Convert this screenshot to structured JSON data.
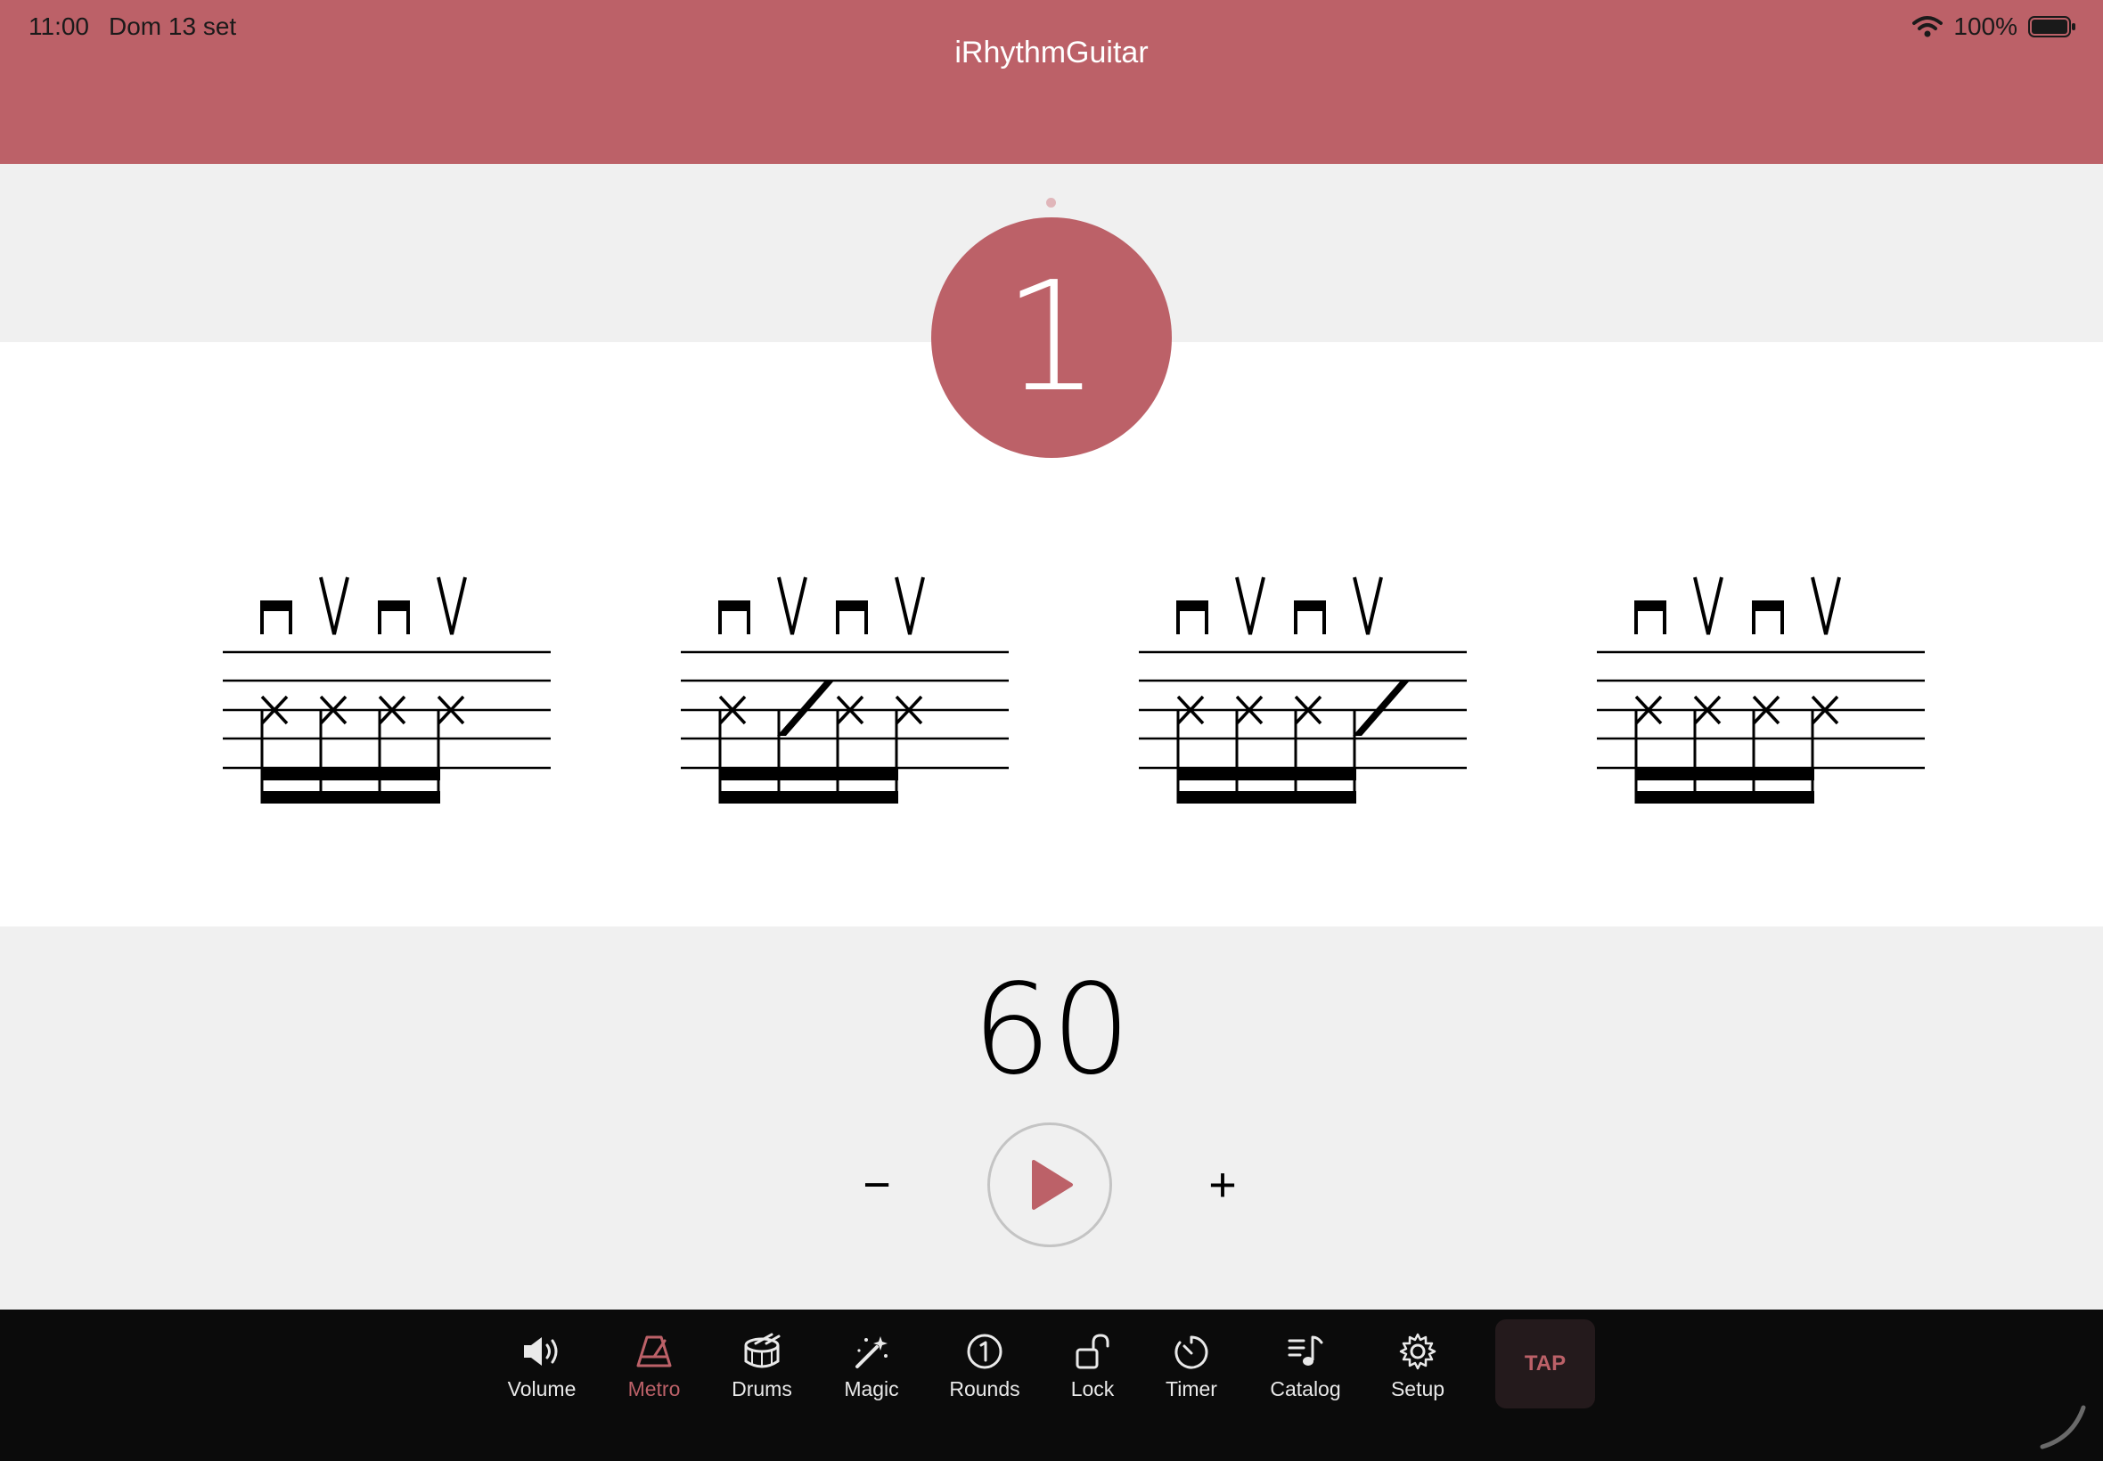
{
  "status_bar": {
    "time": "11:00",
    "date": "Dom 13 set",
    "battery": "100%",
    "wifi_icon": "wifi-icon",
    "battery_icon": "battery-icon"
  },
  "header": {
    "title": "iRhythmGuitar",
    "color": "#bc6168"
  },
  "beat": {
    "current": "1"
  },
  "measures": [
    {
      "strokes": [
        "down",
        "up",
        "down",
        "up"
      ],
      "accent_beat": 0
    },
    {
      "strokes": [
        "down",
        "up",
        "down",
        "up"
      ],
      "accent_beat": 1
    },
    {
      "strokes": [
        "down",
        "up",
        "down",
        "up"
      ],
      "accent_beat": 3
    },
    {
      "strokes": [
        "down",
        "up",
        "down",
        "up"
      ],
      "accent_beat": 0
    }
  ],
  "tempo": {
    "value": "60",
    "minus": "−",
    "plus": "+"
  },
  "toolbar": {
    "items": [
      {
        "label": "Volume",
        "icon": "speaker-icon"
      },
      {
        "label": "Metro",
        "icon": "metronome-icon",
        "active": true
      },
      {
        "label": "Drums",
        "icon": "drum-icon"
      },
      {
        "label": "Magic",
        "icon": "magic-wand-icon"
      },
      {
        "label": "Rounds",
        "icon": "rounds-icon"
      },
      {
        "label": "Lock",
        "icon": "lock-open-icon"
      },
      {
        "label": "Timer",
        "icon": "timer-icon"
      },
      {
        "label": "Catalog",
        "icon": "catalog-icon"
      },
      {
        "label": "Setup",
        "icon": "gear-icon"
      }
    ],
    "tap_label": "TAP"
  }
}
